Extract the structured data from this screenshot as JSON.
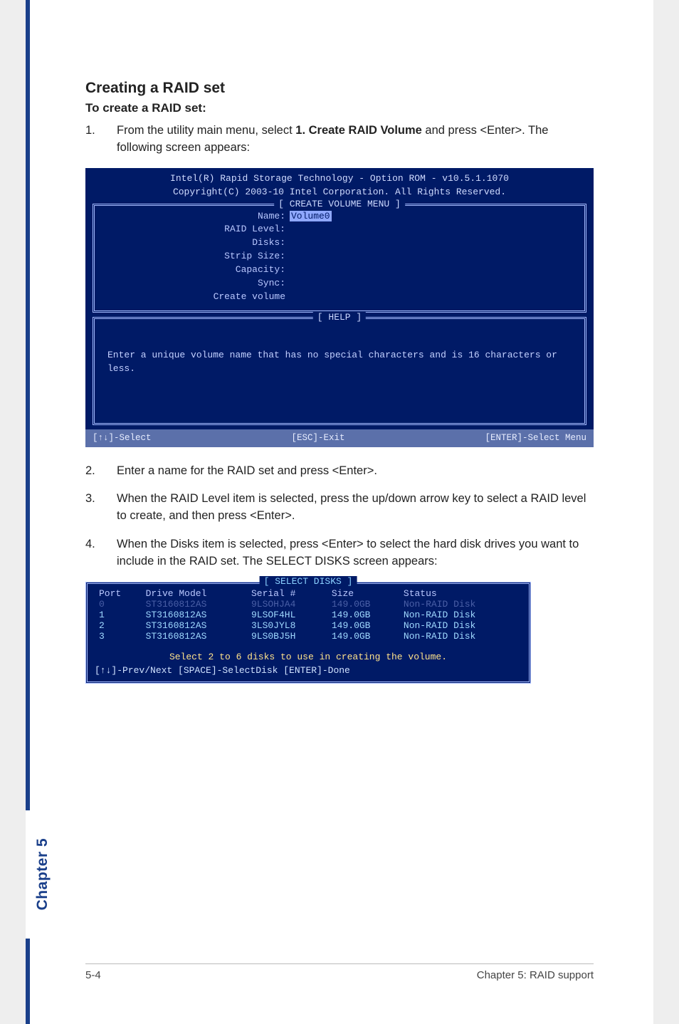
{
  "heading": "Creating a RAID set",
  "subheading": "To create a RAID set:",
  "steps": {
    "one": {
      "num": "1.",
      "prefix": "From the utility main menu, select ",
      "bold": "1. Create RAID Volume",
      "suffix": " and press <Enter>. The following screen appears:"
    },
    "two": {
      "num": "2.",
      "text": "Enter a name for the RAID set and press <Enter>."
    },
    "three": {
      "num": "3.",
      "text": "When the RAID Level item is selected, press the up/down arrow key to select a RAID level to create, and then press <Enter>."
    },
    "four": {
      "num": "4.",
      "text": "When the Disks item is selected, press <Enter> to select the hard disk drives you want to include in the RAID set. The SELECT DISKS screen appears:"
    }
  },
  "bios": {
    "title1": "Intel(R) Rapid Storage Technology - Option ROM - v10.5.1.1070",
    "title2": "Copyright(C) 2003-10 Intel Corporation.  All Rights Reserved.",
    "frame_create_label": "[ CREATE VOLUME MENU ]",
    "fields": {
      "name_k": "Name:",
      "name_v": "Volume0",
      "raid_k": "RAID Level:",
      "disks_k": "Disks:",
      "strip_k": "Strip Size:",
      "capacity_k": "Capacity:",
      "sync_k": "Sync:",
      "create_k": "Create volume"
    },
    "frame_help_label": "[ HELP ]",
    "help_body": "Enter a unique volume name that has no special characters and is 16 characters or less.",
    "footer": {
      "left": "[↑↓]-Select",
      "mid": "[ESC]-Exit",
      "right": "[ENTER]-Select Menu"
    }
  },
  "disks": {
    "frame_label": "[ SELECT DISKS ]",
    "headers": {
      "port": "Port",
      "model": "Drive Model",
      "serial": "Serial #",
      "size": "Size",
      "status": "Status"
    },
    "rows": [
      {
        "port": "0",
        "model": "ST3160812AS",
        "serial": "9LSOHJA4",
        "size": "149.0GB",
        "status": "Non-RAID Disk",
        "dim": true
      },
      {
        "port": "1",
        "model": "ST3160812AS",
        "serial": "9LSOF4HL",
        "size": "149.0GB",
        "status": "Non-RAID Disk",
        "dim": false
      },
      {
        "port": "2",
        "model": "ST3160812AS",
        "serial": "3LS0JYL8",
        "size": "149.0GB",
        "status": "Non-RAID Disk",
        "dim": false
      },
      {
        "port": "3",
        "model": "ST3160812AS",
        "serial": "9LS0BJ5H",
        "size": "149.0GB",
        "status": "Non-RAID Disk",
        "dim": false
      }
    ],
    "msg": "Select 2 to 6 disks to use in creating the volume.",
    "help": "[↑↓]-Prev/Next [SPACE]-SelectDisk [ENTER]-Done"
  },
  "tab_label": "Chapter 5",
  "footer": {
    "left": "5-4",
    "right": "Chapter 5: RAID support"
  }
}
